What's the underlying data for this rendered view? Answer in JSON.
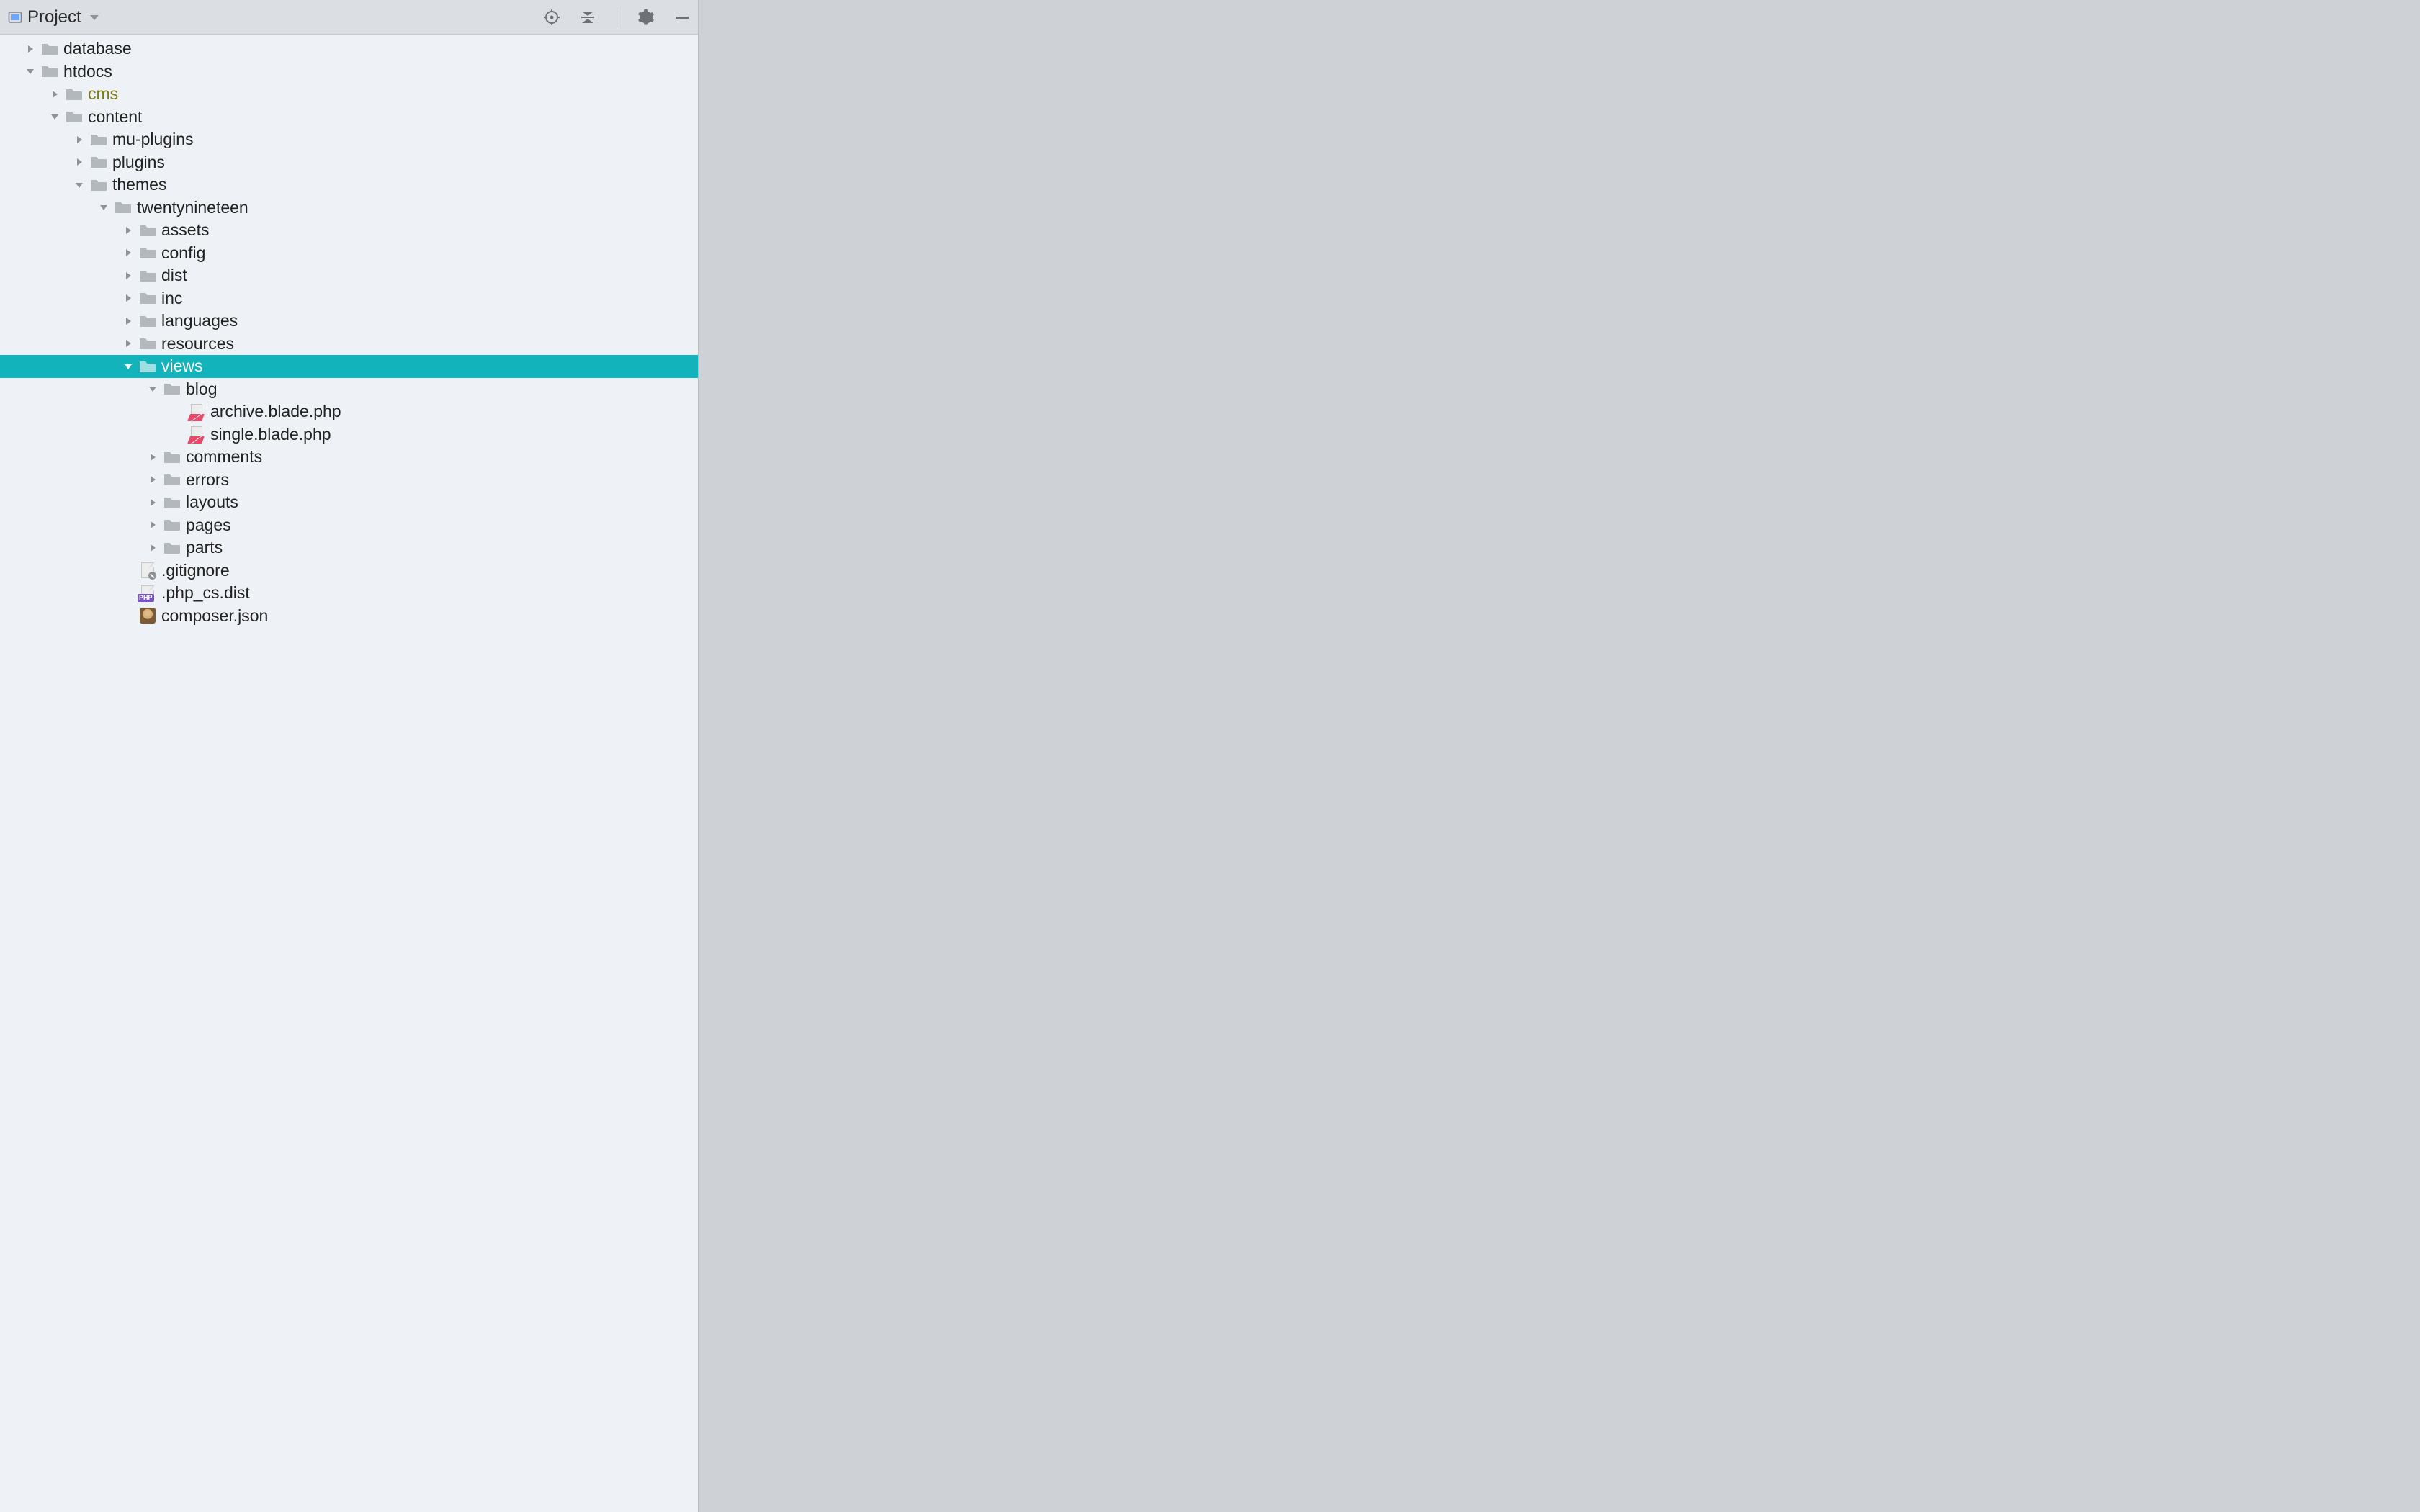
{
  "panel": {
    "title": "Project",
    "icons": {
      "scope": "scope-icon",
      "collapse": "collapse-all-icon",
      "settings": "gear-icon",
      "hide": "hide-icon"
    }
  },
  "colors": {
    "selection": "#12b3bb",
    "folder": "#b3b8bd",
    "special_label": "#7d7a17"
  },
  "tree": [
    {
      "depth": 0,
      "type": "folder",
      "expanded": false,
      "label": "database"
    },
    {
      "depth": 0,
      "type": "folder",
      "expanded": true,
      "label": "htdocs"
    },
    {
      "depth": 1,
      "type": "folder",
      "expanded": false,
      "label": "cms",
      "label_class": "special"
    },
    {
      "depth": 1,
      "type": "folder",
      "expanded": true,
      "label": "content"
    },
    {
      "depth": 2,
      "type": "folder",
      "expanded": false,
      "label": "mu-plugins"
    },
    {
      "depth": 2,
      "type": "folder",
      "expanded": false,
      "label": "plugins"
    },
    {
      "depth": 2,
      "type": "folder",
      "expanded": true,
      "label": "themes"
    },
    {
      "depth": 3,
      "type": "folder",
      "expanded": true,
      "label": "twentynineteen"
    },
    {
      "depth": 4,
      "type": "folder",
      "expanded": false,
      "label": "assets"
    },
    {
      "depth": 4,
      "type": "folder",
      "expanded": false,
      "label": "config"
    },
    {
      "depth": 4,
      "type": "folder",
      "expanded": false,
      "label": "dist"
    },
    {
      "depth": 4,
      "type": "folder",
      "expanded": false,
      "label": "inc"
    },
    {
      "depth": 4,
      "type": "folder",
      "expanded": false,
      "label": "languages"
    },
    {
      "depth": 4,
      "type": "folder",
      "expanded": false,
      "label": "resources"
    },
    {
      "depth": 4,
      "type": "folder",
      "expanded": true,
      "label": "views",
      "selected": true
    },
    {
      "depth": 5,
      "type": "folder",
      "expanded": true,
      "label": "blog"
    },
    {
      "depth": 6,
      "type": "file",
      "file_kind": "blade",
      "label": "archive.blade.php"
    },
    {
      "depth": 6,
      "type": "file",
      "file_kind": "blade",
      "label": "single.blade.php"
    },
    {
      "depth": 5,
      "type": "folder",
      "expanded": false,
      "label": "comments"
    },
    {
      "depth": 5,
      "type": "folder",
      "expanded": false,
      "label": "errors"
    },
    {
      "depth": 5,
      "type": "folder",
      "expanded": false,
      "label": "layouts"
    },
    {
      "depth": 5,
      "type": "folder",
      "expanded": false,
      "label": "pages"
    },
    {
      "depth": 5,
      "type": "folder",
      "expanded": false,
      "label": "parts"
    },
    {
      "depth": 4,
      "type": "file",
      "file_kind": "ignored",
      "label": ".gitignore"
    },
    {
      "depth": 4,
      "type": "file",
      "file_kind": "php_dist",
      "label": ".php_cs.dist"
    },
    {
      "depth": 4,
      "type": "file",
      "file_kind": "composer",
      "label": "composer.json"
    }
  ]
}
